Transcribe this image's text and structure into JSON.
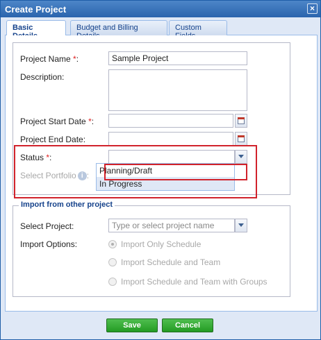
{
  "window": {
    "title": "Create Project",
    "close_glyph": "×"
  },
  "tabs": [
    {
      "label": "Basic Details",
      "active": true
    },
    {
      "label": "Budget and Billing Details",
      "active": false
    },
    {
      "label": "Custom Fields",
      "active": false
    }
  ],
  "form": {
    "project_name_label": "Project Name",
    "project_name_value": "Sample Project",
    "description_label": "Description:",
    "start_date_label": "Project Start Date",
    "end_date_label": "Project End Date:",
    "status_label": "Status",
    "portfolio_label": "Select Portfolio",
    "required_mark": "*",
    "colon": ":",
    "info_glyph": "i",
    "status_options": [
      "Planning/Draft",
      "In Progress"
    ]
  },
  "import": {
    "legend": "Import from other project",
    "select_project_label": "Select Project:",
    "select_project_placeholder": "Type or select project name",
    "options_label": "Import Options:",
    "options": [
      "Import Only Schedule",
      "Import Schedule and Team",
      "Import Schedule and Team with Groups"
    ]
  },
  "buttons": {
    "save": "Save",
    "cancel": "Cancel"
  },
  "colors": {
    "highlight": "#d1222b",
    "button_green": "#239b23",
    "title_blue": "#2a64ad"
  },
  "icons": [
    "close-icon",
    "calendar-icon",
    "chevron-down-icon",
    "info-icon"
  ]
}
